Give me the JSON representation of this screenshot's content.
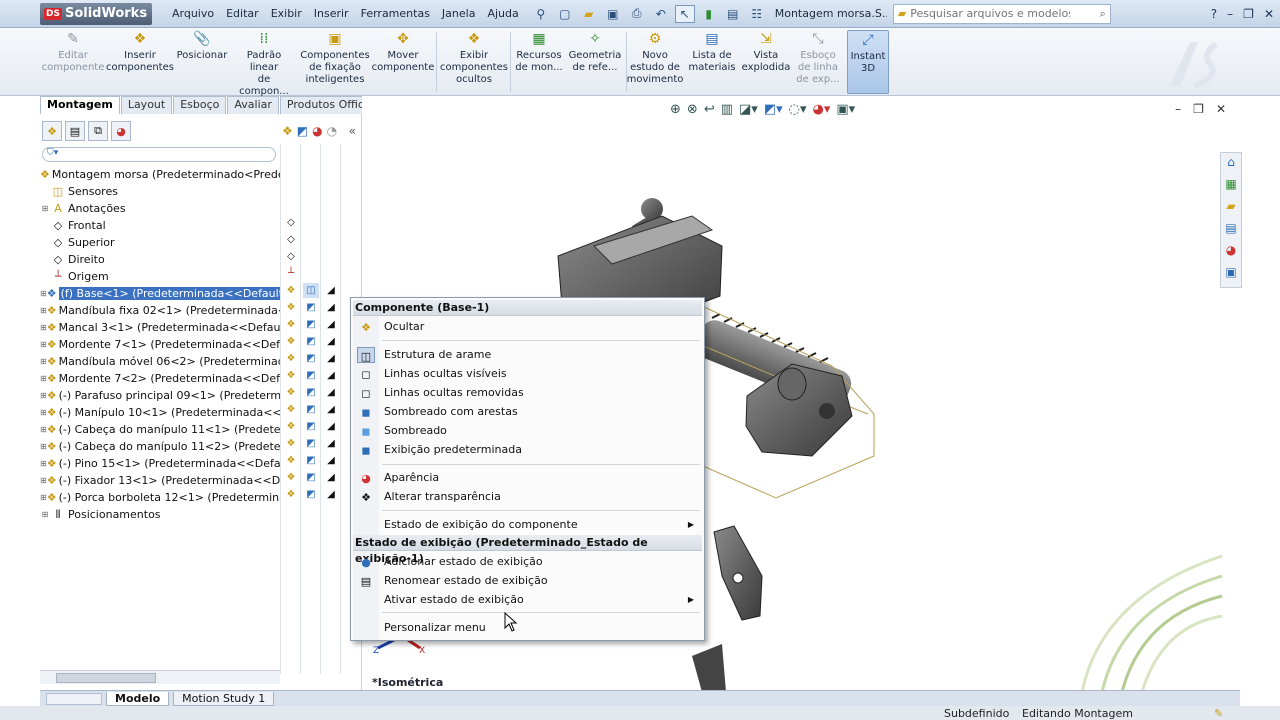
{
  "app": {
    "name": "SolidWorks",
    "ds_badge": "DS",
    "doc_title": "Montagem morsa.S..."
  },
  "menubar": [
    "Arquivo",
    "Editar",
    "Exibir",
    "Inserir",
    "Ferramentas",
    "Janela",
    "Ajuda"
  ],
  "search": {
    "placeholder": "Pesquisar arquivos e modelos"
  },
  "toolbar": [
    {
      "label": "Editar\ncomponente",
      "disabled": true
    },
    {
      "label": "Inserir\ncomponentes",
      "disabled": false
    },
    {
      "label": "Posicionar",
      "disabled": false
    },
    {
      "label": "Padrão linear\nde compon...",
      "disabled": false
    },
    {
      "label": "Componentes\nde fixação\ninteligentes",
      "disabled": false
    },
    {
      "label": "Mover\ncomponente",
      "disabled": false
    },
    {
      "label": "Exibir\ncomponentes\nocultos",
      "disabled": false
    },
    {
      "label": "Recursos\nde mon...",
      "disabled": false
    },
    {
      "label": "Geometria\nde refe...",
      "disabled": false
    },
    {
      "label": "Novo\nestudo de\nmovimento",
      "disabled": false
    },
    {
      "label": "Lista de\nmateriais",
      "disabled": false
    },
    {
      "label": "Vista\nexplodida",
      "disabled": false
    },
    {
      "label": "Esboço\nde linha\nde exp...",
      "disabled": true
    },
    {
      "label": "Instant\n3D",
      "disabled": false
    }
  ],
  "tabs": [
    "Montagem",
    "Layout",
    "Esboço",
    "Avaliar",
    "Produtos Office"
  ],
  "tree": {
    "root": "Montagem morsa  (Predeterminado<Predet",
    "items": [
      {
        "label": "Sensores",
        "icon": "sensor-icon"
      },
      {
        "label": "Anotações",
        "icon": "annotation-icon"
      },
      {
        "label": "Frontal",
        "icon": "plane-icon"
      },
      {
        "label": "Superior",
        "icon": "plane-icon"
      },
      {
        "label": "Direito",
        "icon": "plane-icon"
      },
      {
        "label": "Origem",
        "icon": "origin-icon"
      },
      {
        "label": "(f) Base<1> (Predeterminada<<Default>",
        "icon": "part-icon"
      },
      {
        "label": "Mandíbula fixa 02<1> (Predeterminada<",
        "icon": "part-icon"
      },
      {
        "label": "Mancal 3<1> (Predeterminada<<Default",
        "icon": "part-icon"
      },
      {
        "label": "Mordente 7<1> (Predeterminada<<Defa",
        "icon": "part-icon"
      },
      {
        "label": "Mandíbula móvel 06<2> (Predeterminad",
        "icon": "part-icon"
      },
      {
        "label": "Mordente 7<2> (Predeterminada<<Defa",
        "icon": "part-icon"
      },
      {
        "label": "(-) Parafuso principal 09<1> (Predetermi",
        "icon": "part-icon"
      },
      {
        "label": "(-) Manípulo 10<1> (Predeterminada<<D",
        "icon": "part-icon"
      },
      {
        "label": "(-) Cabeça do manípulo 11<1> (Predeter",
        "icon": "part-icon"
      },
      {
        "label": "(-) Cabeça do manípulo 11<2> (Predeter",
        "icon": "part-icon"
      },
      {
        "label": "(-) Pino 15<1> (Predeterminada<<Defau",
        "icon": "part-icon"
      },
      {
        "label": "(-) Fixador 13<1> (Predeterminada<<Def",
        "icon": "part-icon"
      },
      {
        "label": "(-) Porca borboleta 12<1> (Predetermina",
        "icon": "part-icon"
      },
      {
        "label": "Posicionamentos",
        "icon": "mates-icon"
      }
    ],
    "selected_index": 6
  },
  "context_menu": {
    "header1": "Componente (Base-1)",
    "hide": "Ocultar",
    "display": [
      "Estrutura de arame",
      "Linhas ocultas visíveis",
      "Linhas ocultas removidas",
      "Sombreado com arestas",
      "Sombreado",
      "Exibição predeterminada"
    ],
    "appearance": "Aparência",
    "transparency": "Alterar transparência",
    "component_display_state": "Estado de exibição do componente",
    "header2": "Estado de exibição (Predeterminado_Estado de exibição-1)",
    "add_state": "Adicionar estado de exibição",
    "rename_state": "Renomear estado de exibição",
    "activate_state": "Ativar estado de exibição",
    "customize": "Personalizar menu"
  },
  "viewport": {
    "orientation": "*Isométrica"
  },
  "bottom_tabs": [
    "Modelo",
    "Motion Study 1"
  ],
  "status": {
    "left": "Subdefinido",
    "right": "Editando Montagem"
  },
  "colors": {
    "selection": "#3a71c1",
    "title_bar": "#c3d4e8"
  }
}
